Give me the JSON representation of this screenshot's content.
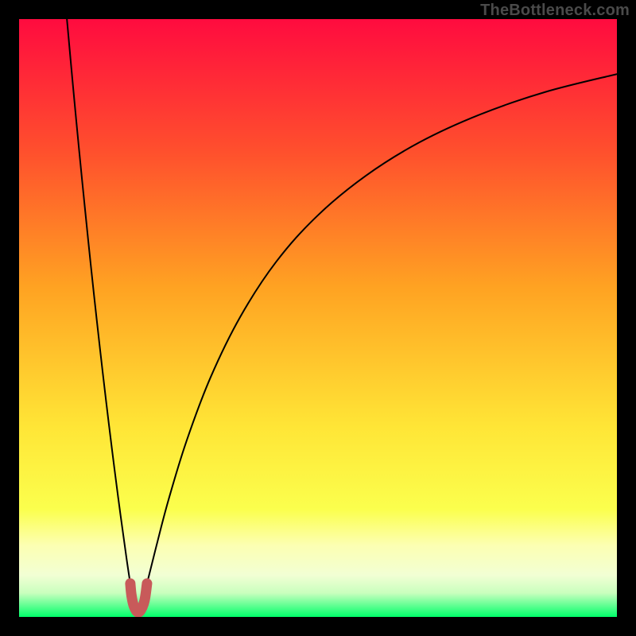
{
  "watermark": {
    "text": "TheBottleneck.com"
  },
  "colors": {
    "frame": "#000000",
    "gradient_top": "#ff0b3f",
    "gradient_mid_upper": "#ff5a2a",
    "gradient_mid": "#ffb421",
    "gradient_mid_lower": "#fff43a",
    "gradient_band": "#fcffb2",
    "gradient_bottom": "#00ff6a",
    "curve": "#000000",
    "marker": "#c85a5a"
  },
  "chart_data": {
    "type": "line",
    "title": "",
    "xlabel": "",
    "ylabel": "",
    "xlim": [
      0,
      100
    ],
    "ylim": [
      0,
      100
    ],
    "grid": false,
    "annotations": [
      "TheBottleneck.com"
    ],
    "series": [
      {
        "name": "left-branch",
        "x": [
          8.0,
          9.0,
          10.0,
          11.0,
          12.0,
          13.0,
          14.0,
          15.0,
          16.0,
          17.0,
          18.0,
          18.6
        ],
        "y": [
          100.0,
          89.0,
          78.5,
          68.5,
          58.8,
          49.6,
          40.8,
          32.4,
          24.4,
          16.8,
          9.6,
          5.6
        ]
      },
      {
        "name": "right-branch",
        "x": [
          21.4,
          23,
          25,
          28,
          32,
          37,
          43,
          50,
          58,
          67,
          77,
          88,
          100
        ],
        "y": [
          5.6,
          12.0,
          19.6,
          29.4,
          40.0,
          50.2,
          59.4,
          67.2,
          73.8,
          79.4,
          84.0,
          87.8,
          90.8
        ]
      }
    ],
    "marker": {
      "name": "optimum-U",
      "x_range": [
        18.2,
        21.8
      ],
      "y_range": [
        0.0,
        5.2
      ],
      "points": [
        {
          "x": 18.6,
          "y": 5.6
        },
        {
          "x": 18.8,
          "y": 3.6
        },
        {
          "x": 19.2,
          "y": 1.8
        },
        {
          "x": 19.8,
          "y": 0.8
        },
        {
          "x": 20.4,
          "y": 1.2
        },
        {
          "x": 21.0,
          "y": 2.8
        },
        {
          "x": 21.4,
          "y": 5.6
        }
      ]
    }
  }
}
